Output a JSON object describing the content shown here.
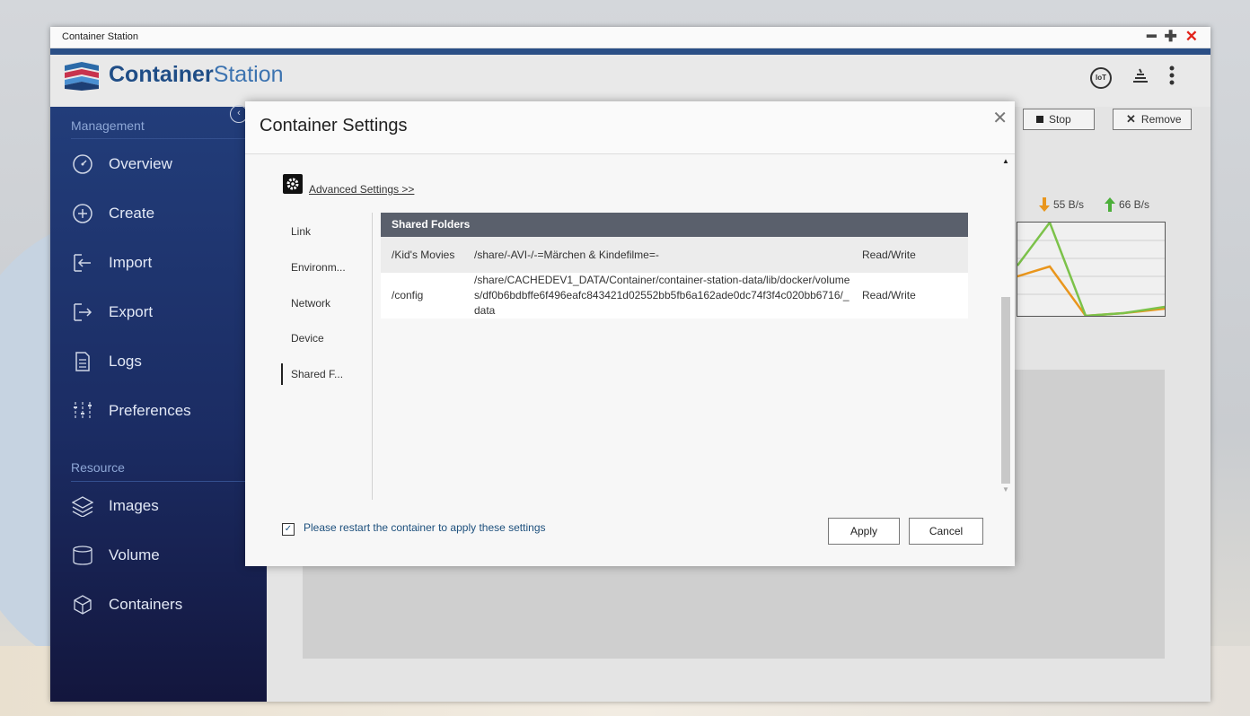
{
  "window": {
    "title": "Container Station",
    "controls": [
      "━",
      "✚",
      "✕"
    ]
  },
  "brand": {
    "bold": "Container",
    "light": "Station"
  },
  "header_icons": {
    "iot": "IoT",
    "stack": "stack-icon",
    "more": "more-icon"
  },
  "sidebar": {
    "management_label": "Management",
    "resource_label": "Resource",
    "items": [
      {
        "label": "Overview",
        "icon": "speedometer-icon"
      },
      {
        "label": "Create",
        "icon": "plus-circle-icon"
      },
      {
        "label": "Import",
        "icon": "import-icon"
      },
      {
        "label": "Export",
        "icon": "export-icon"
      },
      {
        "label": "Logs",
        "icon": "document-icon"
      },
      {
        "label": "Preferences",
        "icon": "sliders-icon"
      }
    ],
    "resource_items": [
      {
        "label": "Images",
        "icon": "layers-icon"
      },
      {
        "label": "Volume",
        "icon": "cylinder-icon"
      },
      {
        "label": "Containers",
        "icon": "cube-icon"
      }
    ]
  },
  "background": {
    "stop_label": "Stop",
    "remove_label": "Remove",
    "down_rate": "55 B/s",
    "up_rate": "66 B/s"
  },
  "dialog": {
    "title": "Container Settings",
    "advanced_link": "Advanced Settings >>",
    "tabs": [
      "Link",
      "Environm...",
      "Network",
      "Device",
      "Shared F..."
    ],
    "active_tab": "Shared F...",
    "table_header": "Shared Folders",
    "rows": [
      {
        "folder": "/Kid's Movies",
        "path": "/share/-AVI-/-=Märchen & Kindefilme=-",
        "mode": "Read/Write"
      },
      {
        "folder": "/config",
        "path": "/share/CACHEDEV1_DATA/Container/container-station-data/lib/docker/volumes/df0b6bdbffe6f496eafc843421d02552bb5fb6a162ade0dc74f3f4c020bb6716/_data",
        "mode": "Read/Write"
      }
    ],
    "restart_checked": true,
    "restart_label": "Please restart the container to apply these settings",
    "apply_label": "Apply",
    "cancel_label": "Cancel"
  }
}
